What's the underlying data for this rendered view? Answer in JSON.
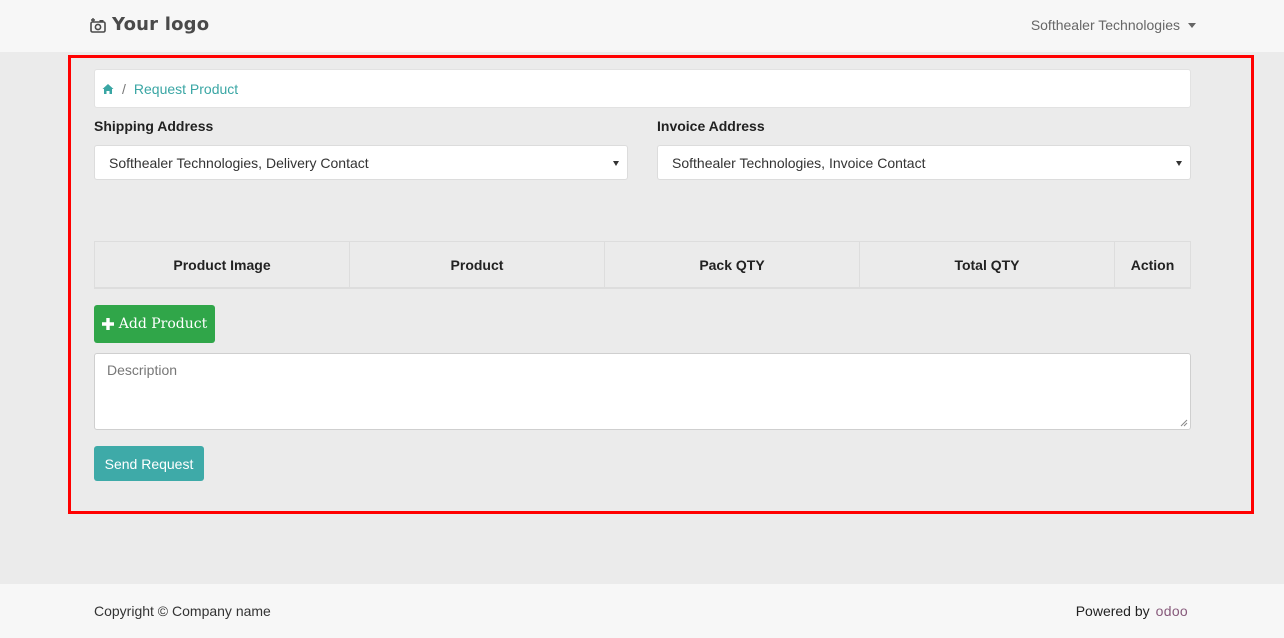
{
  "header": {
    "logo_text": "Your logo",
    "logo_icon": "camera-plus-icon",
    "user_menu_label": "Softhealer Technologies"
  },
  "breadcrumb": {
    "home_icon": "home-icon",
    "separator": "/",
    "current": "Request Product"
  },
  "shipping": {
    "label": "Shipping Address",
    "selected": "Softhealer Technologies, Delivery Contact"
  },
  "invoice": {
    "label": "Invoice Address",
    "selected": "Softhealer Technologies, Invoice Contact"
  },
  "table": {
    "columns": [
      "Product Image",
      "Product",
      "Pack QTY",
      "Total QTY",
      "Action"
    ]
  },
  "actions": {
    "add_product_label": "Add Product",
    "send_request_label": "Send Request"
  },
  "description": {
    "placeholder": "Description",
    "value": ""
  },
  "footer": {
    "copyright": "Copyright © Company name",
    "powered_by": "Powered by",
    "odoo_brand": "odoo"
  },
  "colors": {
    "accent_teal": "#3eaaa8",
    "link_teal": "#3aa6a4",
    "success_green": "#30a649",
    "highlight_red": "#ff0000",
    "odoo_purple": "#875a7b"
  }
}
